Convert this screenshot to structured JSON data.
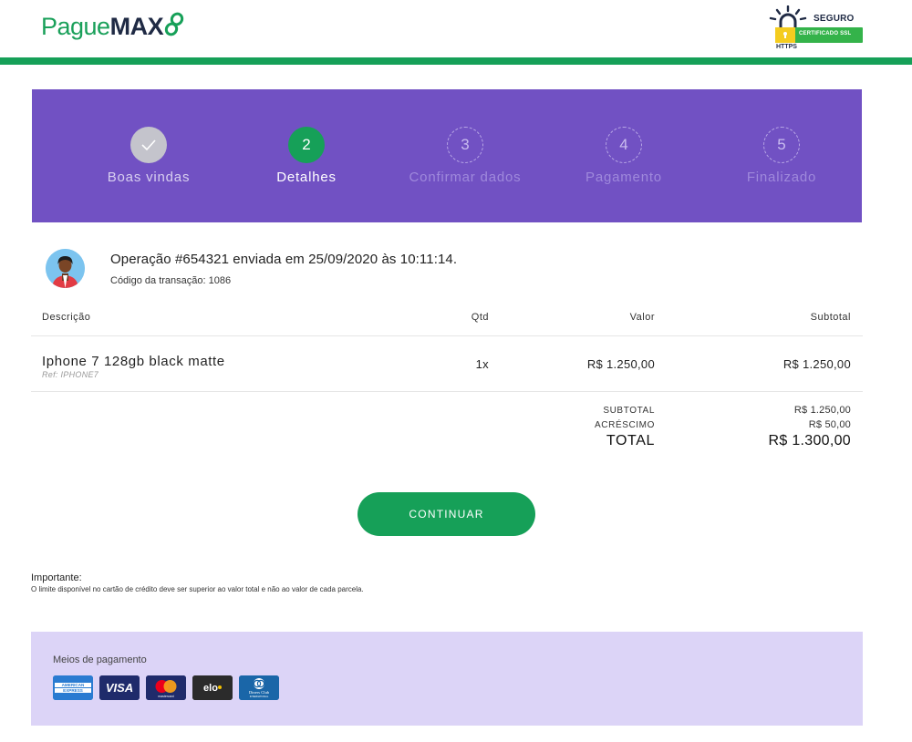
{
  "header": {
    "logo": {
      "part1": "Pague",
      "part2": "MAX"
    },
    "ssl_badge": {
      "seguro": "SEGURO",
      "certificado": "CERTIFICADO SSL",
      "https": "HTTPS"
    }
  },
  "steps": [
    {
      "number": "✓",
      "label": "Boas vindas",
      "state": "done"
    },
    {
      "number": "2",
      "label": "Detalhes",
      "state": "active"
    },
    {
      "number": "3",
      "label": "Confirmar dados",
      "state": "pending"
    },
    {
      "number": "4",
      "label": "Pagamento",
      "state": "pending"
    },
    {
      "number": "5",
      "label": "Finalizado",
      "state": "pending"
    }
  ],
  "operation": {
    "title": "Operação #654321 enviada em 25/09/2020 às 10:11:14.",
    "transaction_code": "Código da transação: 1086"
  },
  "table": {
    "headers": {
      "description": "Descrição",
      "qty": "Qtd",
      "value": "Valor",
      "subtotal": "Subtotal"
    },
    "items": [
      {
        "name": "Iphone 7 128gb black matte",
        "ref": "Ref: IPHONE7",
        "qty": "1x",
        "value": "R$ 1.250,00",
        "subtotal": "R$ 1.250,00"
      }
    ]
  },
  "summary": {
    "subtotal_label": "SUBTOTAL",
    "subtotal_value": "R$ 1.250,00",
    "surcharge_label": "ACRÉSCIMO",
    "surcharge_value": "R$ 50,00",
    "total_label": "TOTAL",
    "total_value": "R$ 1.300,00"
  },
  "actions": {
    "continue_label": "CONTINUAR"
  },
  "notice": {
    "title": "Importante:",
    "text": "O limite disponível no cartão de crédito deve ser superior ao valor total e não ao valor de cada parcela."
  },
  "payments": {
    "title": "Meios de pagamento",
    "cards": [
      {
        "name": "amex-card-icon",
        "label": "AMERICAN EXPRESS"
      },
      {
        "name": "visa-card-icon",
        "label": "VISA"
      },
      {
        "name": "mastercard-card-icon",
        "label": "mastercard"
      },
      {
        "name": "elo-card-icon",
        "label": "elo"
      },
      {
        "name": "diners-card-icon",
        "label": "Diners Club INTERNATIONAL"
      }
    ]
  },
  "colors": {
    "brand_green": "#16a058",
    "brand_purple": "#7151c3",
    "payments_bg": "#dcd4f7"
  }
}
